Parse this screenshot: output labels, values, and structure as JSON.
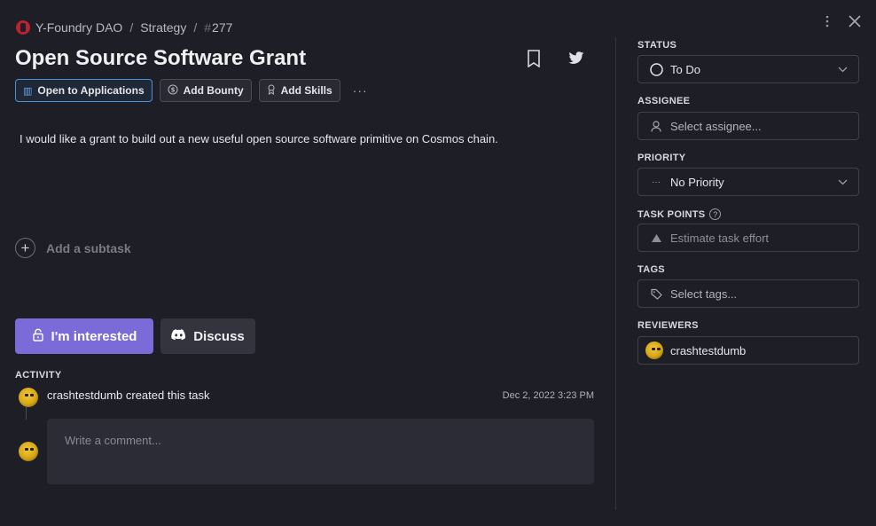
{
  "breadcrumb": {
    "org": "Y-Foundry DAO",
    "separator": "/",
    "project": "Strategy",
    "hash": "#",
    "task_number": "277"
  },
  "task": {
    "title": "Open Source Software Grant",
    "description": "I would like a grant to build out a new useful open source software primitive on Cosmos chain."
  },
  "chips": {
    "status_label": "Open to Applications",
    "bounty_label": "Add Bounty",
    "skills_label": "Add Skills",
    "more_label": "···"
  },
  "subtask": {
    "label": "Add a subtask"
  },
  "actions": {
    "interested_label": "I'm interested",
    "discuss_label": "Discuss"
  },
  "activity": {
    "heading": "ACTIVITY",
    "entry_text": "crashtestdumb created this task",
    "entry_time": "Dec 2, 2022 3:23 PM",
    "comment_placeholder": "Write a comment..."
  },
  "sidebar": {
    "status": {
      "label": "STATUS",
      "value": "To Do"
    },
    "assignee": {
      "label": "ASSIGNEE",
      "placeholder": "Select assignee..."
    },
    "priority": {
      "label": "PRIORITY",
      "value": "No Priority",
      "icon_text": "···"
    },
    "task_points": {
      "label": "TASK POINTS",
      "help": "?",
      "placeholder": "Estimate task effort"
    },
    "tags": {
      "label": "TAGS",
      "placeholder": "Select tags..."
    },
    "reviewers": {
      "label": "REVIEWERS",
      "value": "crashtestdumb"
    }
  },
  "colors": {
    "background": "#1e1e26",
    "accent": "#7b6bd9",
    "chip_active_border": "#4a90d9",
    "field_border": "#40404a"
  },
  "icons": [
    "kebab-menu-icon",
    "close-icon",
    "bookmark-icon",
    "twitter-icon",
    "lock-icon",
    "discord-icon",
    "plus-icon",
    "user-icon",
    "tag-icon",
    "triangle-icon",
    "chevron-down-icon",
    "circle-status-icon",
    "help-icon"
  ]
}
